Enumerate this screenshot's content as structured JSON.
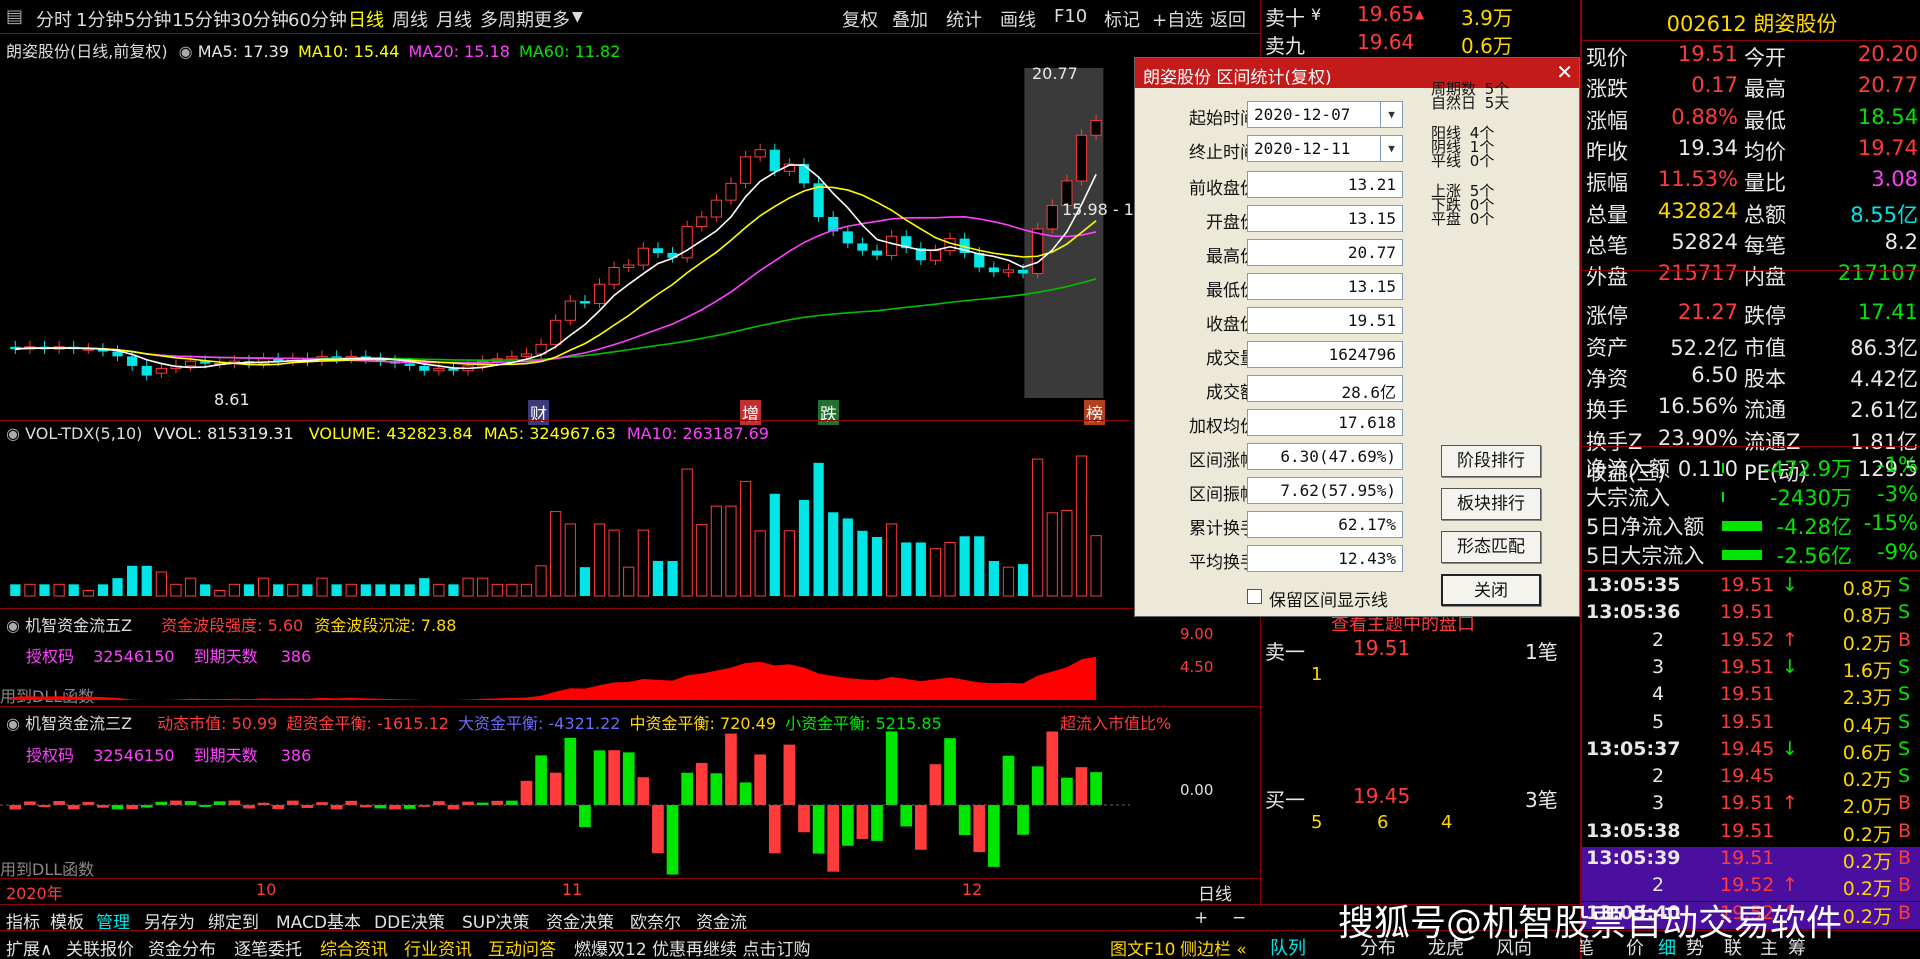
{
  "toolbar": {
    "items": [
      "分时",
      "1分钟",
      "5分钟",
      "15分钟",
      "30分钟",
      "60分钟",
      "日线",
      "周线",
      "月线",
      "多周期",
      "更多"
    ],
    "right": [
      "复权",
      "叠加",
      "统计",
      "画线",
      "F10",
      "标记",
      "+自选",
      "返回"
    ]
  },
  "chart": {
    "title": "朗姿股份(日线,前复权)",
    "ma5": "MA5: 17.39",
    "ma10": "MA10: 15.44",
    "ma20": "MA20: 15.18",
    "ma60": "MA60: 11.82",
    "high_label": "20.77",
    "low_label": "8.61",
    "range_label": "15.98 - 1",
    "markers": [
      "财",
      "增",
      "跌",
      "榜"
    ],
    "candles_o": [
      10.1,
      10.0,
      10.1,
      10.0,
      10.1,
      10.0,
      10.0,
      9.9,
      9.7,
      9.3,
      9.0,
      9.2,
      9.3,
      9.5,
      9.4,
      9.4,
      9.5,
      9.4,
      9.6,
      9.5,
      9.6,
      9.5,
      9.7,
      9.6,
      9.7,
      9.6,
      9.5,
      9.4,
      9.3,
      9.1,
      9.2,
      9.1,
      9.3,
      9.5,
      9.6,
      9.7,
      9.8,
      10.2,
      11.2,
      12.0,
      11.9,
      12.7,
      13.4,
      13.5,
      14.2,
      14.0,
      13.8,
      15.1,
      15.5,
      16.2,
      16.9,
      18.0,
      18.3,
      17.4,
      17.7,
      16.9,
      15.5,
      14.9,
      14.4,
      14.1,
      13.9,
      14.7,
      14.2,
      13.7,
      14.1,
      14.6,
      14.0,
      13.4,
      13.2,
      13.3,
      13.15,
      15.0,
      15.98,
      17.0,
      18.9
    ],
    "candles_c": [
      10.0,
      10.1,
      10.0,
      10.1,
      10.0,
      10.0,
      9.9,
      9.7,
      9.3,
      8.9,
      9.2,
      9.3,
      9.5,
      9.4,
      9.4,
      9.5,
      9.4,
      9.6,
      9.5,
      9.6,
      9.5,
      9.7,
      9.6,
      9.7,
      9.6,
      9.5,
      9.4,
      9.3,
      9.1,
      9.2,
      9.1,
      9.3,
      9.5,
      9.6,
      9.7,
      9.8,
      10.2,
      11.2,
      12.0,
      11.9,
      12.7,
      13.4,
      13.5,
      14.2,
      14.0,
      13.8,
      15.1,
      15.5,
      16.2,
      16.9,
      18.0,
      18.3,
      17.4,
      17.7,
      16.9,
      15.5,
      14.9,
      14.4,
      14.1,
      13.9,
      14.7,
      14.2,
      13.7,
      14.1,
      14.6,
      14.0,
      13.4,
      13.2,
      13.3,
      13.15,
      15.0,
      15.98,
      17.0,
      18.9,
      19.51
    ],
    "vol_labels": {
      "title": "VOL-TDX(5,10)",
      "vvol": "VVOL: 815319.31",
      "volume": "VOLUME: 432823.84",
      "ma5": "MA5: 324967.63",
      "ma10": "MA10: 263187.69"
    },
    "flow5": {
      "title": "机智资金流五Z",
      "s1": "资金波段强度: 5.60",
      "s2": "资金波段沉淀: 7.88",
      "auth": "授权码",
      "auth_code": "32546150",
      "expire": "到期天数",
      "expire_val": "386",
      "dll": "用到DLL函数",
      "axis1": "9.00",
      "axis2": "4.50"
    },
    "flow3": {
      "title": "机智资金流三Z",
      "s1": "动态市值: 50.99",
      "s2": "超资金平衡: -1615.12",
      "s3": "大资金平衡: -4321.22",
      "s4": "中资金平衡: 720.49",
      "s5": "小资金平衡: 5215.85",
      "s6": "超流入市值比%",
      "auth": "授权码",
      "auth_code": "32546150",
      "expire": "到期天数",
      "expire_val": "386",
      "dll": "用到DLL函数",
      "axis": "0.00"
    },
    "xaxis": [
      "2020年",
      "10",
      "11",
      "12"
    ],
    "period": "日线"
  },
  "dialog": {
    "title": "朗姿股份 区间统计(复权)",
    "start_label": "起始时间",
    "start_value": "2020-12-07",
    "end_label": "终止时间",
    "end_value": "2020-12-11",
    "rows": [
      {
        "label": "前收盘价",
        "value": "13.21"
      },
      {
        "label": "开盘价",
        "value": "13.15"
      },
      {
        "label": "最高价",
        "value": "20.77"
      },
      {
        "label": "最低价",
        "value": "13.15"
      },
      {
        "label": "收盘价",
        "value": "19.51"
      },
      {
        "label": "成交量",
        "value": "1624796"
      },
      {
        "label": "成交额",
        "value": "28.6亿"
      },
      {
        "label": "加权均价",
        "value": "17.618"
      },
      {
        "label": "区间涨幅",
        "value": "6.30(47.69%)"
      },
      {
        "label": "区间振幅",
        "value": "7.62(57.95%)"
      },
      {
        "label": "累计换手",
        "value": "62.17%"
      },
      {
        "label": "平均换手",
        "value": "12.43%"
      }
    ],
    "stats": [
      {
        "k": "周期数",
        "v": "5个"
      },
      {
        "k": "自然日",
        "v": "5天"
      },
      {
        "k": "阳线",
        "v": "4个"
      },
      {
        "k": "阴线",
        "v": "1个"
      },
      {
        "k": "平线",
        "v": "0个"
      },
      {
        "k": "上涨",
        "v": "5个"
      },
      {
        "k": "下跌",
        "v": "0个"
      },
      {
        "k": "平盘",
        "v": "0个"
      }
    ],
    "buttons": [
      "阶段排行",
      "板块排行",
      "形态匹配",
      "关闭"
    ],
    "checkbox": "保留区间显示线"
  },
  "orderbook": {
    "ask10": {
      "label": "卖十",
      "price": "19.65",
      "vol": "3.9万"
    },
    "ask9": {
      "label": "卖九",
      "price": "19.64",
      "vol": "0.6万"
    },
    "ask1": {
      "label": "卖一",
      "price": "19.51",
      "vol": "1笔",
      "sub": "1"
    },
    "bid1": {
      "label": "买一",
      "price": "19.45",
      "vol": "3笔",
      "sub1": "5",
      "sub2": "6",
      "sub3": "4"
    },
    "overlay": "查看主题中的盘口"
  },
  "quote": {
    "code": "002612 朗姿股份",
    "rows": [
      [
        "现价",
        "19.51",
        "今开",
        "20.20"
      ],
      [
        "涨跌",
        "0.17",
        "最高",
        "20.77"
      ],
      [
        "涨幅",
        "0.88%",
        "最低",
        "18.54"
      ],
      [
        "昨收",
        "19.34",
        "均价",
        "19.74"
      ],
      [
        "振幅",
        "11.53%",
        "量比",
        "3.08"
      ],
      [
        "总量",
        "432824",
        "总额",
        "8.55亿"
      ],
      [
        "总笔",
        "52824",
        "每笔",
        "8.2"
      ],
      [
        "外盘",
        "215717",
        "内盘",
        "217107"
      ],
      [
        "涨停",
        "21.27",
        "跌停",
        "17.41"
      ],
      [
        "资产",
        "52.2亿",
        "市值",
        "86.3亿"
      ],
      [
        "净资",
        "6.50",
        "股本",
        "4.42亿"
      ],
      [
        "换手",
        "16.56%",
        "流通",
        "2.61亿"
      ],
      [
        "换手Z",
        "23.90%",
        "流通Z",
        "1.81亿"
      ],
      [
        "收益(三)",
        "0.110",
        "PE(动)",
        "129.5"
      ]
    ],
    "flows": [
      [
        "净流入额",
        "-472.9万",
        "-1%"
      ],
      [
        "大宗流入",
        "-2430万",
        "-3%"
      ],
      [
        "5日净流入额",
        "-4.28亿",
        "-15%"
      ],
      [
        "5日大宗流入",
        "-2.56亿",
        "-9%"
      ]
    ],
    "ticks": [
      [
        "13:05:35",
        "19.51",
        "↓",
        "0.8万",
        "S"
      ],
      [
        "13:05:36",
        "19.51",
        "",
        "0.8万",
        "S"
      ],
      [
        "2",
        "19.52",
        "↑",
        "0.2万",
        "B"
      ],
      [
        "3",
        "19.51",
        "↓",
        "1.6万",
        "S"
      ],
      [
        "4",
        "19.51",
        "",
        "2.3万",
        "S"
      ],
      [
        "5",
        "19.51",
        "",
        "0.4万",
        "S"
      ],
      [
        "13:05:37",
        "19.45",
        "↓",
        "0.6万",
        "S"
      ],
      [
        "2",
        "19.45",
        "",
        "0.2万",
        "S"
      ],
      [
        "3",
        "19.51",
        "↑",
        "2.0万",
        "B"
      ],
      [
        "13:05:38",
        "19.51",
        "",
        "0.2万",
        "B"
      ],
      [
        "13:05:39",
        "19.51",
        "",
        "0.2万",
        "B"
      ],
      [
        "2",
        "19.52",
        "↑",
        "0.2万",
        "B"
      ],
      [
        "13:05:40",
        "19.52",
        "↑",
        "0.2万",
        "B"
      ]
    ],
    "tabs": [
      "队列",
      "分布",
      "龙虎",
      "风向",
      "笔",
      "价",
      "细",
      "势",
      "联",
      "主",
      "筹"
    ]
  },
  "bottombar": {
    "row1": [
      "指标",
      "模板",
      "管理",
      "另存为",
      "绑定到",
      "MACD基本",
      "DDE决策",
      "SUP决策",
      "资金决策",
      "欧奈尔",
      "资金流"
    ],
    "row2": [
      "扩展∧",
      "关联报价",
      "资金分布",
      "逐笔委托",
      "综合资讯",
      "行业资讯",
      "互动问答",
      "燃爆双12 优惠再继续 点击订购"
    ],
    "right": [
      "图文F10",
      "侧边栏 «"
    ]
  },
  "watermark": "搜狐号@机智股票自动交易软件"
}
